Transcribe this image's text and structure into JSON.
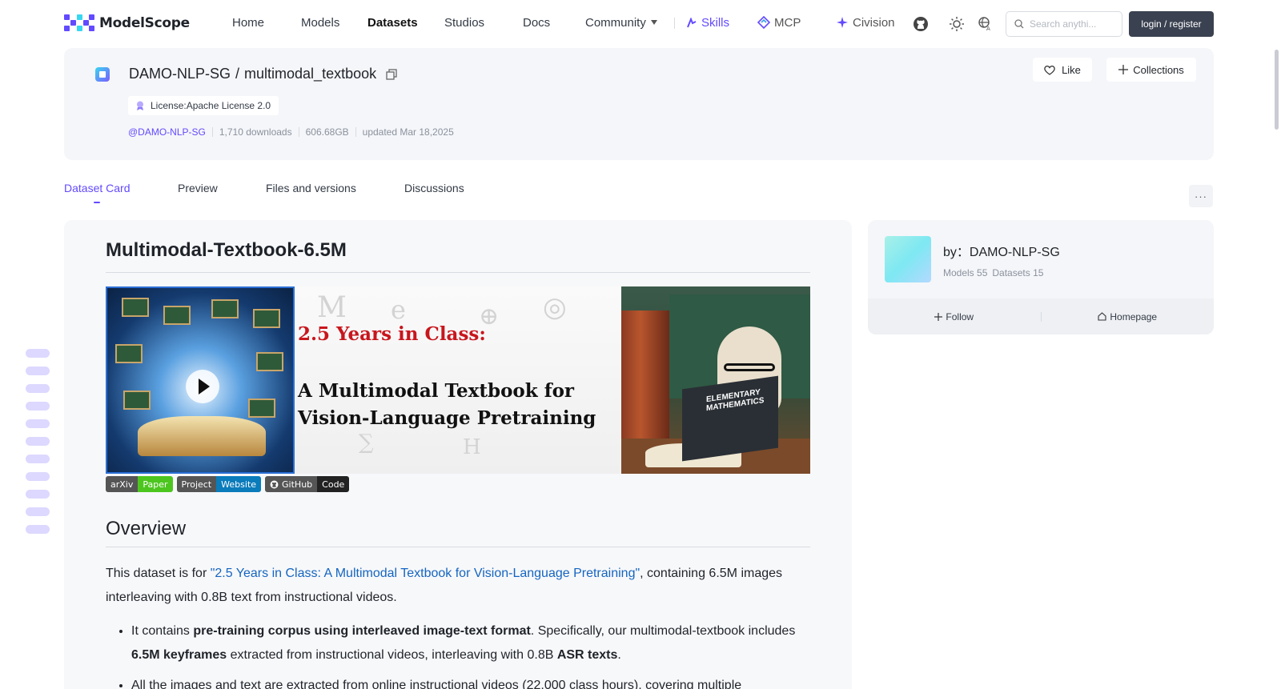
{
  "brand": {
    "name": "ModelScope",
    "accent": "#624aff"
  },
  "nav": {
    "items": [
      "Home",
      "Models",
      "Datasets",
      "Studios",
      "Docs",
      "Community"
    ],
    "active": "Datasets",
    "skills": "Skills",
    "mcp": "MCP",
    "civision": "Civision",
    "search_placeholder": "Search anythi...",
    "login": "login / register"
  },
  "dataset": {
    "org": "DAMO-NLP-SG",
    "slash": "/",
    "name": "multimodal_textbook",
    "license": "License:Apache License 2.0",
    "org_handle": "@DAMO-NLP-SG",
    "downloads": "1,710 downloads",
    "size": "606.68GB",
    "updated": "updated Mar 18,2025",
    "like": "Like",
    "collections": "Collections"
  },
  "tabs": [
    "Dataset Card",
    "Preview",
    "Files and versions",
    "Discussions"
  ],
  "tabs_active": "Dataset Card",
  "more": "···",
  "card": {
    "title": "Multimodal-Textbook-6.5M",
    "banner": {
      "line1": "2.5 Years in Class:",
      "line2": "A Multimodal Textbook for",
      "line3": "Vision-Language Pretraining",
      "book_label": "ELEMENTARY MATHEMATICS"
    },
    "badges": [
      {
        "left": "arXiv",
        "right": "Paper",
        "color": "#4cc61e"
      },
      {
        "left": "Project",
        "right": "Website",
        "color": "#0a7bbb"
      },
      {
        "left": "GitHub",
        "right": "Code",
        "color": "#222222"
      }
    ],
    "overview_heading": "Overview",
    "p1_pre": "This dataset is for ",
    "p1_link": "\"2.5 Years in Class: A Multimodal Textbook for Vision-Language Pretraining\"",
    "p1_post": ", containing 6.5M images interleaving with 0.8B text from instructional videos.",
    "li1_a": "It contains ",
    "li1_b": "pre-training corpus using interleaved image-text format",
    "li1_c": ". Specifically, our multimodal-textbook includes ",
    "li1_d": "6.5M keyframes",
    "li1_e": " extracted from instructional videos, interleaving with 0.8B ",
    "li1_f": "ASR texts",
    "li1_g": ".",
    "li2": "All the images and text are extracted from online instructional videos (22,000 class hours), covering multiple"
  },
  "author": {
    "by_label": "by：DAMO-NLP-SG",
    "models": "Models 55",
    "datasets": "Datasets 15",
    "follow": "Follow",
    "homepage": "Homepage"
  }
}
